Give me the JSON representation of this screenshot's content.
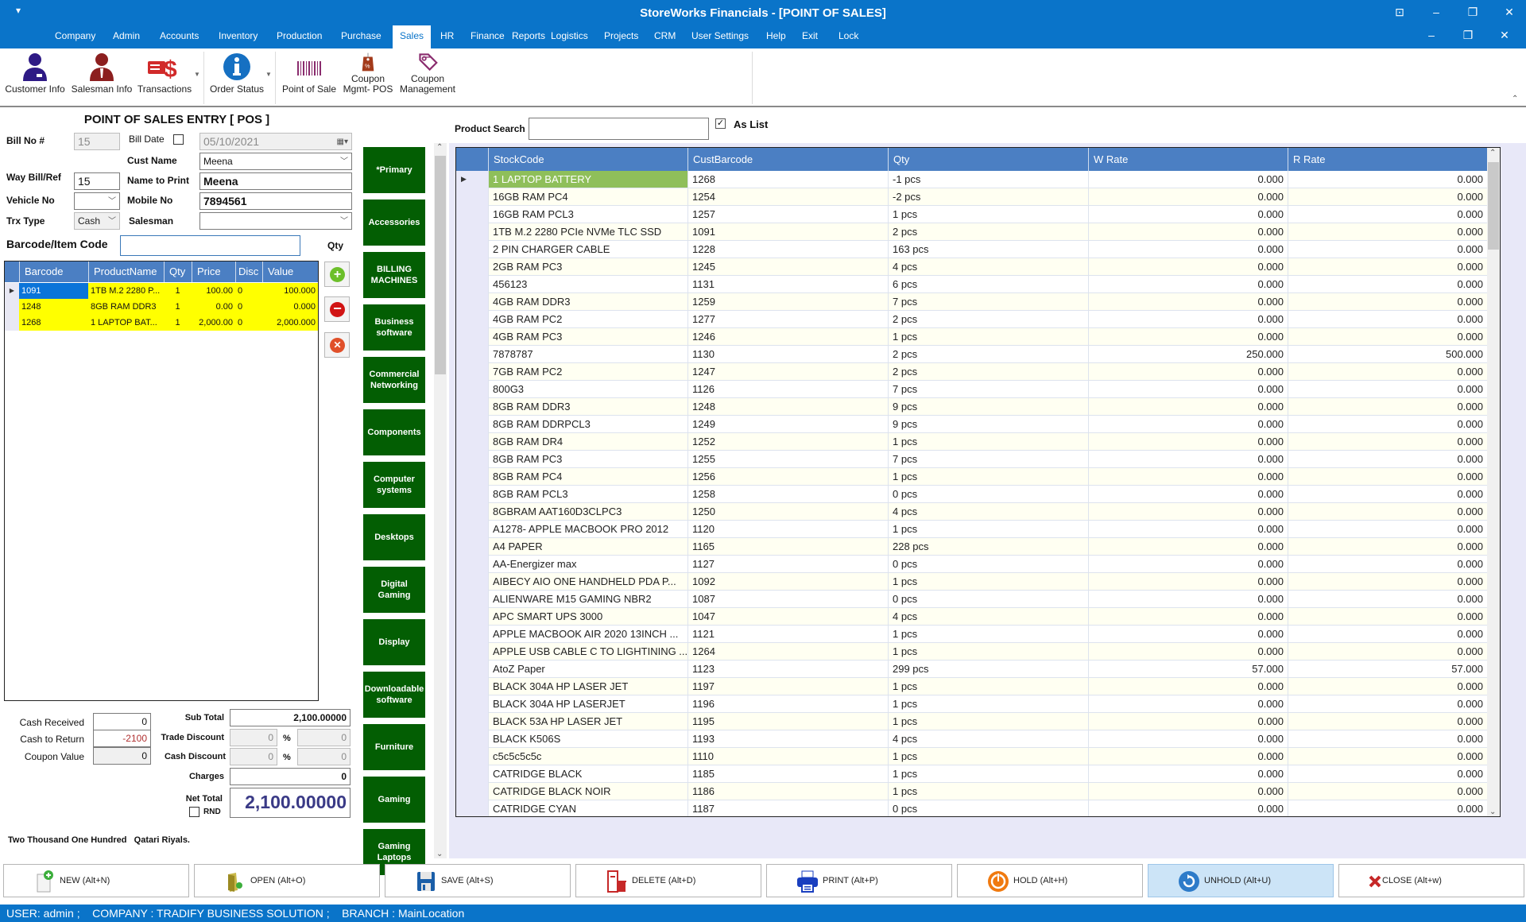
{
  "window": {
    "title": "StoreWorks Financials - [POINT OF SALES]",
    "quick_access": "▾"
  },
  "menu": {
    "items": [
      "Company",
      "Admin",
      "Accounts",
      "Inventory",
      "Production",
      "Purchase",
      "Sales",
      "HR",
      "Finance",
      "Reports",
      "Logistics",
      "Projects",
      "CRM",
      "User Settings",
      "Help",
      "Exit",
      "Lock"
    ],
    "active": "Sales"
  },
  "ribbon": {
    "items": [
      {
        "label": "Customer Info",
        "icon": "customer-icon"
      },
      {
        "label": "Salesman Info",
        "icon": "salesman-icon"
      },
      {
        "label": "Transactions",
        "icon": "transactions-icon",
        "dropdown": true
      },
      {
        "label": "Order Status",
        "icon": "info-icon",
        "dropdown": true
      },
      {
        "label": "Point of Sale",
        "icon": "barcode-icon"
      },
      {
        "label": "Coupon\nMgmt- POS",
        "line1": "Coupon",
        "line2": "Mgmt- POS",
        "icon": "coupon-tag-icon"
      },
      {
        "label": "Coupon\nManagement",
        "line1": "Coupon",
        "line2": "Management",
        "icon": "coupon-tags-icon"
      }
    ]
  },
  "form": {
    "title": "POINT OF SALES ENTRY [ POS ]",
    "bill_no_label": "Bill No #",
    "bill_no": "15",
    "bill_date_label": "Bill Date",
    "bill_date_checked": false,
    "bill_date": "05/10/2021",
    "cust_name_label": "Cust Name",
    "cust_name": "Meena",
    "way_bill_label": "Way Bill/Ref",
    "way_bill": "15",
    "name_to_print_label": "Name to Print",
    "name_to_print": "Meena",
    "vehicle_no_label": "Vehicle No",
    "vehicle_no": "",
    "mobile_no_label": "Mobile No",
    "mobile_no": "7894561",
    "trx_type_label": "Trx Type",
    "trx_type": "Cash",
    "salesman_label": "Salesman",
    "salesman": "",
    "barcode_label": "Barcode/Item Code",
    "barcode_value": "",
    "qty_label": "Qty"
  },
  "cart": {
    "columns": [
      "Barcode",
      "ProductName",
      "Qty",
      "Price",
      "Disc",
      "Value"
    ],
    "rows": [
      {
        "barcode": "1091",
        "product": "1TB M.2 2280 P...",
        "qty": "1",
        "price": "100.00",
        "disc": "0",
        "value": "100.000",
        "selected": true
      },
      {
        "barcode": "1248",
        "product": "8GB RAM DDR3",
        "qty": "1",
        "price": "0.00",
        "disc": "0",
        "value": "0.000"
      },
      {
        "barcode": "1268",
        "product": "1 LAPTOP BAT...",
        "qty": "1",
        "price": "2,000.00",
        "disc": "0",
        "value": "2,000.000"
      }
    ]
  },
  "totals": {
    "cash_received_label": "Cash Received",
    "cash_received": "0",
    "cash_to_return_label": "Cash to Return",
    "cash_to_return": "-2100",
    "coupon_value_label": "Coupon Value",
    "coupon_value": "0",
    "sub_total_label": "Sub Total",
    "sub_total": "2,100.00000",
    "trade_discount_label": "Trade Discount",
    "trade_discount_pct": "0",
    "trade_discount_amt": "0",
    "cash_discount_label": "Cash Discount",
    "cash_discount_pct": "0",
    "cash_discount_amt": "0",
    "pct_symbol": "%",
    "charges_label": "Charges",
    "charges": "0",
    "net_total_label": "Net Total",
    "net_total": "2,100.00000",
    "rnd_label": "RND",
    "rnd_checked": false,
    "amount_in_words": "Two Thousand One Hundred   Qatari Riyals."
  },
  "categories": [
    "*Primary",
    "Accessories",
    "BILLING MACHINES",
    "Business software",
    "Commercial Networking",
    "Components",
    "Computer systems",
    "Desktops",
    "Digital Gaming",
    "Display",
    "Downloadable software",
    "Furniture",
    "Gaming",
    "Gaming Laptops"
  ],
  "category_colors": {
    "button_bg": "#035e03",
    "button_text": "#ffffff"
  },
  "product_search": {
    "label": "Product Search",
    "value": "",
    "as_list_label": "As List",
    "as_list_checked": true
  },
  "products": {
    "columns": [
      "StockCode",
      "CustBarcode",
      "Qty",
      "W Rate",
      "R Rate"
    ],
    "rows": [
      [
        "1 LAPTOP BATTERY",
        "1268",
        "-1 pcs",
        "0.000",
        "0.000"
      ],
      [
        "16GB RAM PC4",
        "1254",
        "-2 pcs",
        "0.000",
        "0.000"
      ],
      [
        "16GB RAM PCL3",
        "1257",
        "1 pcs",
        "0.000",
        "0.000"
      ],
      [
        "1TB M.2 2280 PCIe NVMe TLC SSD",
        "1091",
        "2 pcs",
        "0.000",
        "0.000"
      ],
      [
        "2 PIN CHARGER CABLE",
        "1228",
        "163 pcs",
        "0.000",
        "0.000"
      ],
      [
        "2GB RAM PC3",
        "1245",
        "4 pcs",
        "0.000",
        "0.000"
      ],
      [
        "456123",
        "1131",
        "6 pcs",
        "0.000",
        "0.000"
      ],
      [
        "4GB RAM DDR3",
        "1259",
        "7 pcs",
        "0.000",
        "0.000"
      ],
      [
        "4GB RAM PC2",
        "1277",
        "2 pcs",
        "0.000",
        "0.000"
      ],
      [
        "4GB RAM PC3",
        "1246",
        "1 pcs",
        "0.000",
        "0.000"
      ],
      [
        "7878787",
        "1130",
        "2 pcs",
        "250.000",
        "500.000"
      ],
      [
        "7GB RAM PC2",
        "1247",
        "2 pcs",
        "0.000",
        "0.000"
      ],
      [
        "800G3",
        "1126",
        "7 pcs",
        "0.000",
        "0.000"
      ],
      [
        "8GB RAM DDR3",
        "1248",
        "9 pcs",
        "0.000",
        "0.000"
      ],
      [
        "8GB RAM DDRPCL3",
        "1249",
        "9 pcs",
        "0.000",
        "0.000"
      ],
      [
        "8GB RAM DR4",
        "1252",
        "1 pcs",
        "0.000",
        "0.000"
      ],
      [
        "8GB RAM PC3",
        "1255",
        "7 pcs",
        "0.000",
        "0.000"
      ],
      [
        "8GB RAM PC4",
        "1256",
        "1 pcs",
        "0.000",
        "0.000"
      ],
      [
        "8GB RAM PCL3",
        "1258",
        "0 pcs",
        "0.000",
        "0.000"
      ],
      [
        "8GBRAM AAT160D3CLPC3",
        "1250",
        "4 pcs",
        "0.000",
        "0.000"
      ],
      [
        "A1278- APPLE MACBOOK PRO 2012",
        "1120",
        "1 pcs",
        "0.000",
        "0.000"
      ],
      [
        "A4 PAPER",
        "1165",
        "228 pcs",
        "0.000",
        "0.000"
      ],
      [
        "AA-Energizer max",
        "1127",
        "0 pcs",
        "0.000",
        "0.000"
      ],
      [
        "AIBECY AIO ONE HANDHELD PDA P...",
        "1092",
        "1 pcs",
        "0.000",
        "0.000"
      ],
      [
        "ALIENWARE M15 GAMING NBR2",
        "1087",
        "0 pcs",
        "0.000",
        "0.000"
      ],
      [
        "APC SMART UPS 3000",
        "1047",
        "4 pcs",
        "0.000",
        "0.000"
      ],
      [
        "APPLE MACBOOK AIR 2020 13INCH ...",
        "1121",
        "1 pcs",
        "0.000",
        "0.000"
      ],
      [
        "APPLE USB CABLE C TO LIGHTINING ...",
        "1264",
        "1 pcs",
        "0.000",
        "0.000"
      ],
      [
        "AtoZ Paper",
        "1123",
        "299 pcs",
        "57.000",
        "57.000"
      ],
      [
        "BLACK 304A HP LASER JET",
        "1197",
        "1 pcs",
        "0.000",
        "0.000"
      ],
      [
        "BLACK 304A HP LASERJET",
        "1196",
        "1 pcs",
        "0.000",
        "0.000"
      ],
      [
        "BLACK 53A HP LASER JET",
        "1195",
        "1 pcs",
        "0.000",
        "0.000"
      ],
      [
        "BLACK K506S",
        "1193",
        "4 pcs",
        "0.000",
        "0.000"
      ],
      [
        "c5c5c5c5c",
        "1110",
        "1 pcs",
        "0.000",
        "0.000"
      ],
      [
        "CATRIDGE BLACK",
        "1185",
        "1 pcs",
        "0.000",
        "0.000"
      ],
      [
        "CATRIDGE BLACK NOIR",
        "1186",
        "1 pcs",
        "0.000",
        "0.000"
      ],
      [
        "CATRIDGE CYAN",
        "1187",
        "0 pcs",
        "0.000",
        "0.000"
      ]
    ],
    "selected_row": 0
  },
  "actions": [
    {
      "label": "NEW (Alt+N)",
      "icon": "new-document-icon"
    },
    {
      "label": "OPEN (Alt+O)",
      "icon": "open-folder-icon"
    },
    {
      "label": "SAVE (Alt+S)",
      "icon": "save-icon"
    },
    {
      "label": "DELETE (Alt+D)",
      "icon": "delete-icon"
    },
    {
      "label": "PRINT (Alt+P)",
      "icon": "print-icon"
    },
    {
      "label": "HOLD (Alt+H)",
      "icon": "power-icon"
    },
    {
      "label": "UNHOLD (Alt+U)",
      "icon": "refresh-icon",
      "active": true
    },
    {
      "label": "CLOSE (Alt+w)",
      "icon": "close-icon"
    }
  ],
  "status": {
    "text": "USER: admin ;    COMPANY : TRADIFY BUSINESS SOLUTION ;    BRANCH : MainLocation"
  },
  "colors": {
    "brand": "#0a74c9",
    "grid_header": "#4b7fc3",
    "cart_row": "#ffff00",
    "selected_cell": "#0a74d9",
    "highlight_product": "#8fbf5a",
    "net_total_text": "#3a3a86",
    "negative": "#b03030"
  }
}
